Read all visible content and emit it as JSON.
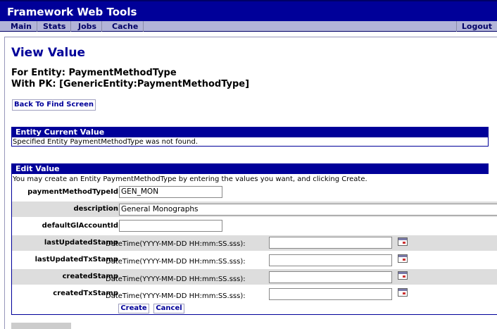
{
  "app_title": "Framework Web Tools",
  "nav": {
    "items": [
      "Main",
      "Stats",
      "Jobs",
      "Cache"
    ],
    "logout": "Logout"
  },
  "page_title": "View Value",
  "entity_line": "For Entity: PaymentMethodType",
  "pk_line": "With PK: [GenericEntity:PaymentMethodType]",
  "back_button": "Back To Find Screen",
  "current_value": {
    "heading": "Entity Current Value",
    "message": "Specified Entity PaymentMethodType was not found."
  },
  "edit_value": {
    "heading": "Edit Value",
    "message": "You may create an Entity PaymentMethodType by entering the values you want, and clicking Create.",
    "fields": [
      {
        "label": "paymentMethodTypeId",
        "value": ""
      },
      {
        "label": "description",
        "value": ""
      },
      {
        "label": "defaultGlAccountId",
        "value": ""
      },
      {
        "label": "lastUpdatedStamp",
        "value": ""
      },
      {
        "label": "lastUpdatedTxStamp",
        "value": ""
      },
      {
        "label": "createdStamp",
        "value": ""
      },
      {
        "label": "createdTxStamp",
        "value": ""
      }
    ],
    "payment_method_type_id": "GEN_MON",
    "description": "General Monographs",
    "default_gl_account_id": "",
    "datetime_hint": "DateTime(YYYY-MM-DD HH:mm:SS.sss):",
    "create_button": "Create",
    "cancel_button": "Cancel"
  }
}
